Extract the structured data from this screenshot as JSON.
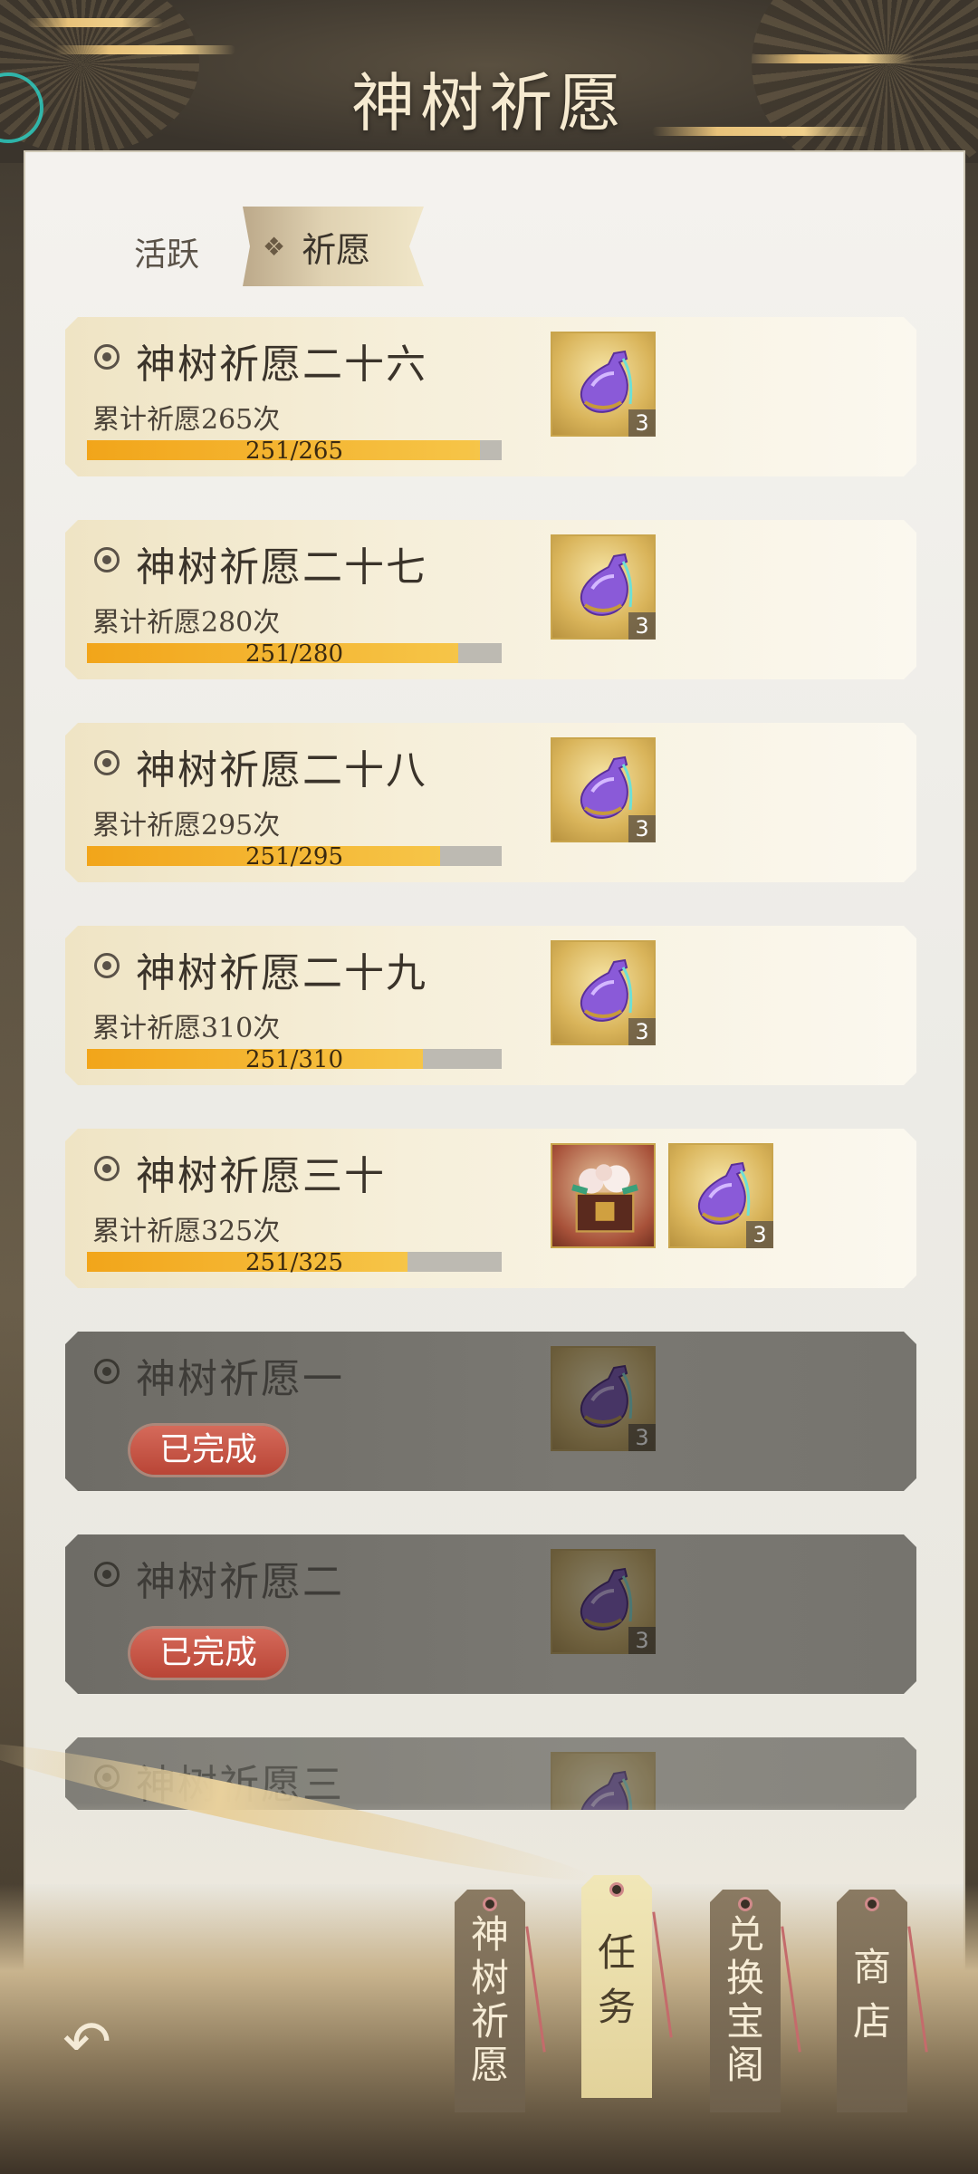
{
  "header": {
    "title": "神树祈愿"
  },
  "tabs": {
    "active_label": "活跃",
    "selected_label": "祈愿"
  },
  "tasks": [
    {
      "name": "神树祈愿二十六",
      "requirement": "累计祈愿265次",
      "progress_text": "251/265",
      "progress": 0.947,
      "rewards": [
        {
          "icon": "purple-potion-icon",
          "qty": "3"
        }
      ],
      "status": "in-progress"
    },
    {
      "name": "神树祈愿二十七",
      "requirement": "累计祈愿280次",
      "progress_text": "251/280",
      "progress": 0.896,
      "rewards": [
        {
          "icon": "purple-potion-icon",
          "qty": "3"
        }
      ],
      "status": "in-progress"
    },
    {
      "name": "神树祈愿二十八",
      "requirement": "累计祈愿295次",
      "progress_text": "251/295",
      "progress": 0.851,
      "rewards": [
        {
          "icon": "purple-potion-icon",
          "qty": "3"
        }
      ],
      "status": "in-progress"
    },
    {
      "name": "神树祈愿二十九",
      "requirement": "累计祈愿310次",
      "progress_text": "251/310",
      "progress": 0.81,
      "rewards": [
        {
          "icon": "purple-potion-icon",
          "qty": "3"
        }
      ],
      "status": "in-progress"
    },
    {
      "name": "神树祈愿三十",
      "requirement": "累计祈愿325次",
      "progress_text": "251/325",
      "progress": 0.772,
      "rewards": [
        {
          "icon": "flower-gift-box-icon",
          "qty": ""
        },
        {
          "icon": "purple-potion-icon",
          "qty": "3"
        }
      ],
      "status": "in-progress"
    },
    {
      "name": "神树祈愿一",
      "badge": "已完成",
      "rewards": [
        {
          "icon": "purple-potion-icon",
          "qty": "3"
        }
      ],
      "status": "completed"
    },
    {
      "name": "神树祈愿二",
      "badge": "已完成",
      "rewards": [
        {
          "icon": "purple-potion-icon",
          "qty": "3"
        }
      ],
      "status": "completed"
    },
    {
      "name": "神树祈愿三",
      "rewards": [
        {
          "icon": "purple-potion-icon",
          "qty": ""
        }
      ],
      "status": "completed"
    }
  ],
  "bottom_nav": [
    {
      "label": "神树祈愿",
      "active": false
    },
    {
      "label": "任务",
      "active": true
    },
    {
      "label": "兑换宝阁",
      "active": false
    },
    {
      "label": "商店",
      "active": false
    }
  ],
  "colors": {
    "progress_fill": "#f2a51a",
    "badge_red": "#c0493a",
    "active_tag": "#ece0a8"
  }
}
